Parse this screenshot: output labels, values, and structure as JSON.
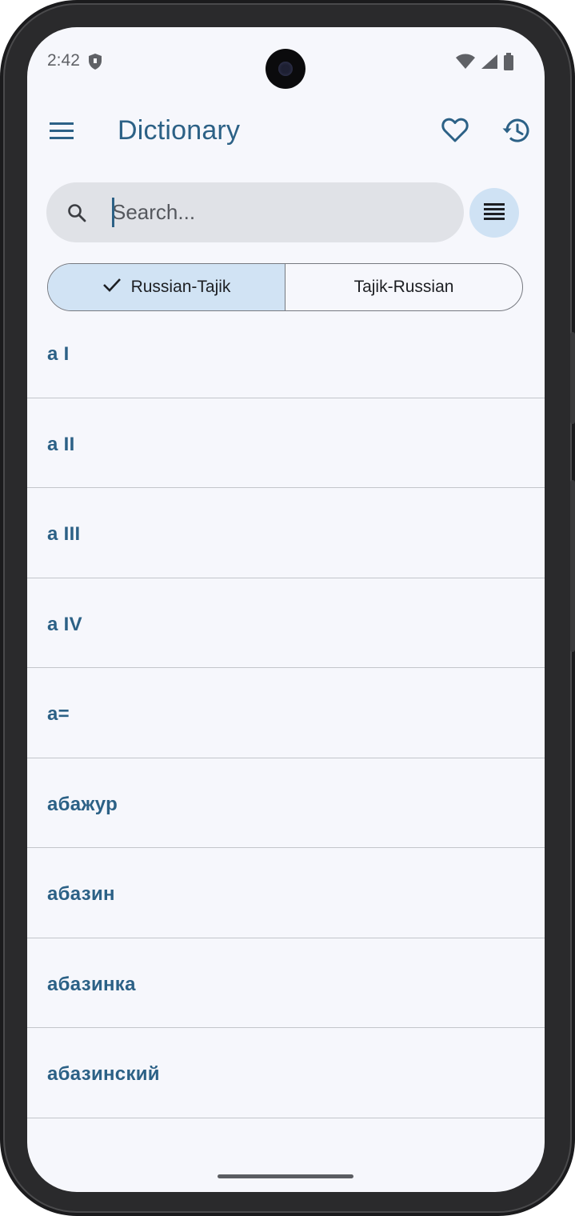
{
  "status_bar": {
    "time": "2:42"
  },
  "app_bar": {
    "title": "Dictionary"
  },
  "search": {
    "placeholder": "Search...",
    "value": ""
  },
  "direction_toggle": {
    "options": [
      {
        "label": "Russian-Tajik",
        "selected": true
      },
      {
        "label": "Tajik-Russian",
        "selected": false
      }
    ]
  },
  "words": [
    "а I",
    "а II",
    "а III",
    "а IV",
    "а=",
    "абажур",
    "абазин",
    "абазинка",
    "абазинский"
  ],
  "colors": {
    "accent": "#2c6186",
    "selected_segment": "#d1e3f4",
    "search_bg": "#e0e2e7",
    "background": "#f6f7fc"
  }
}
